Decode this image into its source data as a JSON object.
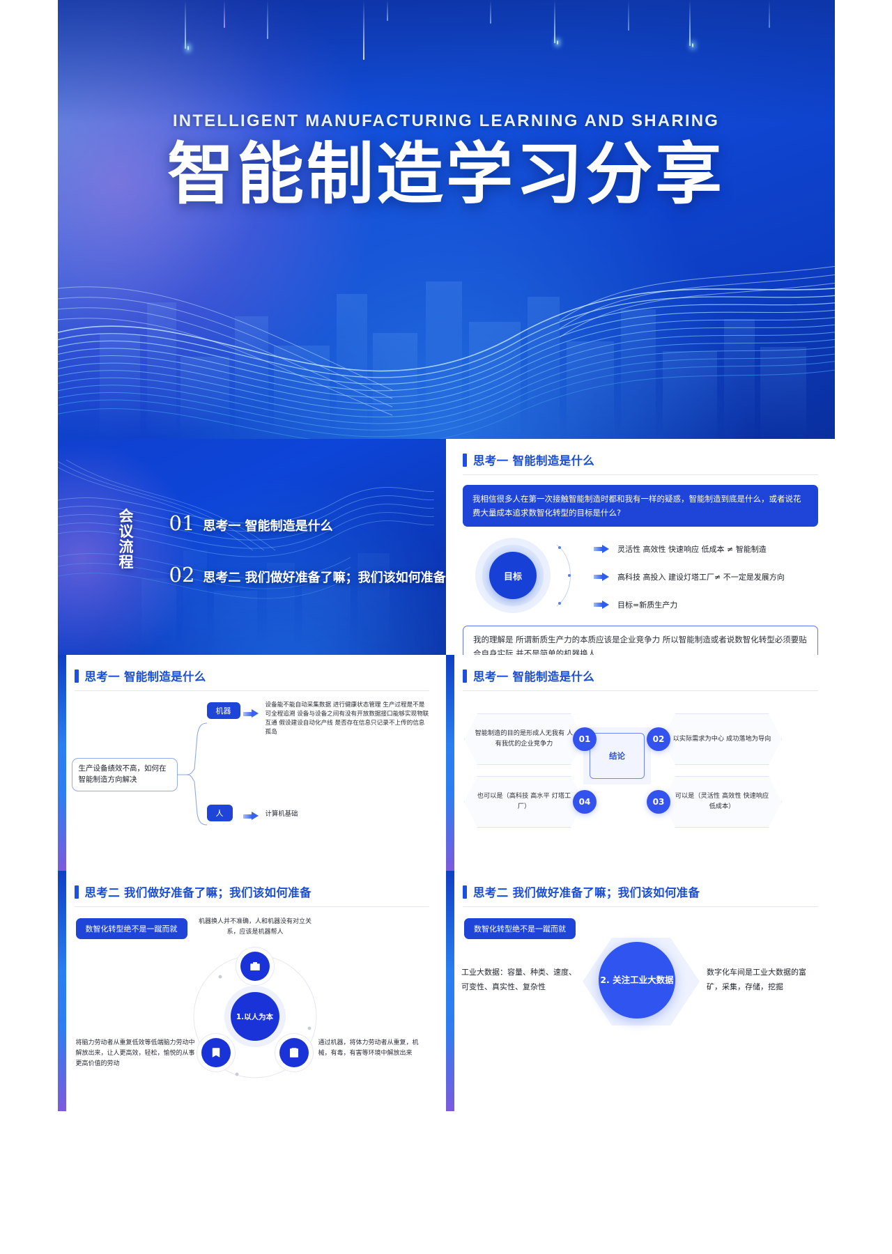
{
  "hero": {
    "subtitle": "INTELLIGENT  MANUFACTURING  LEARNING  AND  SHARING",
    "title": "智能制造学习分享"
  },
  "agenda": {
    "label": "会议流程",
    "items": [
      {
        "num": "01",
        "text": "思考一  智能制造是什么"
      },
      {
        "num": "02",
        "text": "思考二 我们做好准备了嘛；我们该如何准备"
      }
    ]
  },
  "slide_goal": {
    "heading": "思考一  智能制造是什么",
    "callout": "我相信很多人在第一次接触智能制造时都和我有一样的疑惑，智能制造到底是什么，或者说花费大量成本追求数智化转型的目标是什么?",
    "core_label": "目标",
    "points": [
      "灵活性 高效性 快速响应 低成本 ≠ 智能制造",
      "高科技 高投入 建设灯塔工厂≠ 不一定是发展方向",
      "目标=新质生产力"
    ],
    "conclusion": "我的理解是 所谓新质生产力的本质应该是企业竞争力 所以智能制造或者说数智化转型必须要贴合自身实际 并不是简单的机器换人"
  },
  "slide_mind": {
    "heading": "思考一  智能制造是什么",
    "root": "生产设备绩效不高，如何在智能制造方向解决",
    "branches": [
      {
        "chip": "机器",
        "text": "设备能不能自动采集数据 进行健康状态管理 生产过程是不是可全程追溯 设备与设备之间有没有开放数据接口能够实现物联互通  假设建设自动化产线 是否存在信息只记录不上传的信息孤岛"
      },
      {
        "chip": "人",
        "text": "计算机基础"
      }
    ]
  },
  "slide_hex": {
    "heading": "思考一  智能制造是什么",
    "center": "结论",
    "nodes": [
      {
        "num": "01",
        "text": "智能制造的目的是形成人无我有  人有我优的企业竞争力"
      },
      {
        "num": "02",
        "text": "以实际需求为中心 成功落地为导向"
      },
      {
        "num": "03",
        "text": "可以是（灵活性 高效性 快速响应 低成本）"
      },
      {
        "num": "04",
        "text": "也可以是（高科技 高水平 灯塔工厂）"
      }
    ]
  },
  "slide_circle": {
    "heading": "思考二 我们做好准备了嘛；我们该如何准备",
    "chip": "数智化转型绝不是一蹴而就",
    "top_note": "机器换人并不准确，人和机器没有对立关系，应该是机器帮人",
    "center": "1.以人为本",
    "left_text": "将脑力劳动者从重复低效等低端脑力劳动中解放出来，让人更高效，轻松，愉悦的从事更高价值的劳动",
    "right_text": "通过机器，将体力劳动者从重复，机械，有毒，有害等环境中解放出来",
    "icons": [
      "briefcase-icon",
      "book-icon",
      "clipboard-icon"
    ]
  },
  "slide_bigdata": {
    "heading": "思考二 我们做好准备了嘛；我们该如何准备",
    "chip": "数智化转型绝不是一蹴而就",
    "left_text": "工业大数据：容量、种类、速度、可变性、真实性、复杂性",
    "center": "2. 关注工业大数据",
    "right_text": "数字化车间是工业大数据的富矿，采集，存储，挖掘"
  },
  "colors": {
    "brand_blue": "#1f44d8",
    "accent_blue": "#3352ee",
    "heading_blue": "#1b4fd8",
    "hero_blue": "#1250dd"
  }
}
